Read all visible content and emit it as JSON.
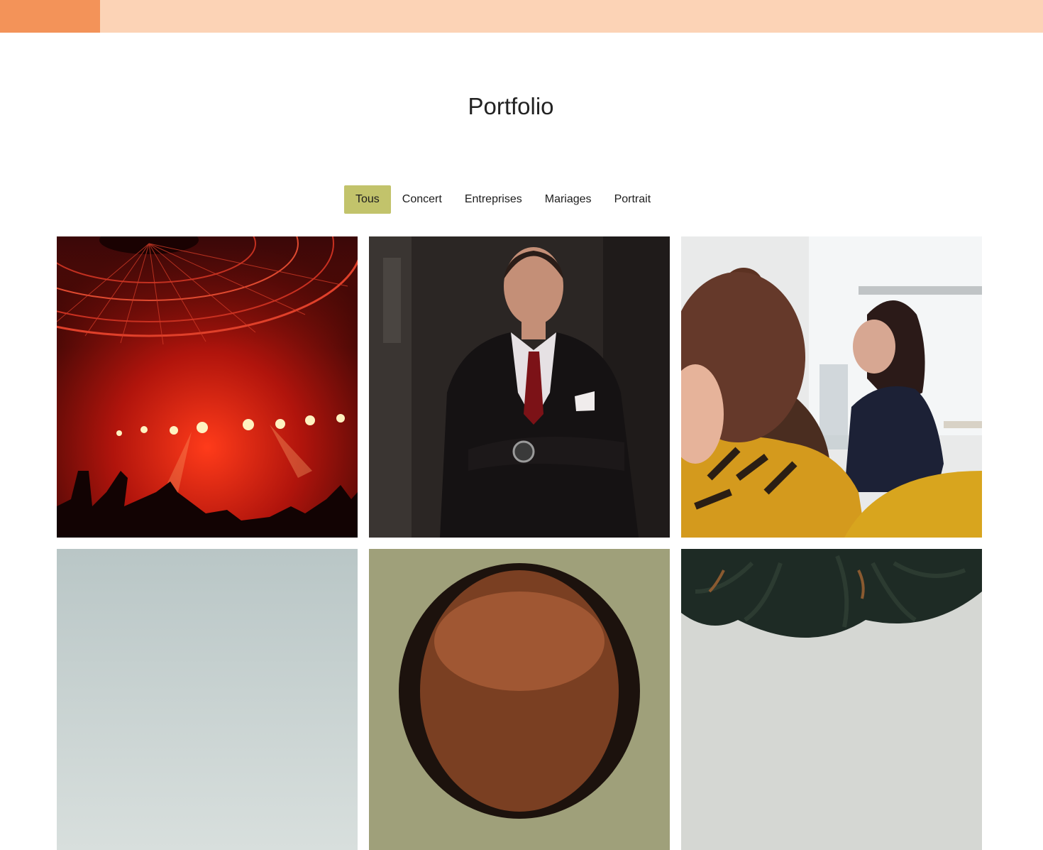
{
  "header": {
    "bar_color": "#fcd3b6",
    "accent_color": "#f39359"
  },
  "page": {
    "title": "Portfolio"
  },
  "filters": {
    "active_color": "#c2c36b",
    "items": [
      {
        "label": "Tous",
        "active": true
      },
      {
        "label": "Concert",
        "active": false
      },
      {
        "label": "Entreprises",
        "active": false
      },
      {
        "label": "Mariages",
        "active": false
      },
      {
        "label": "Portrait",
        "active": false
      }
    ]
  },
  "gallery": {
    "items": [
      {
        "subject": "concert-stage-photo"
      },
      {
        "subject": "businessman-portrait-photo"
      },
      {
        "subject": "office-meeting-photo"
      },
      {
        "subject": "sky-photo"
      },
      {
        "subject": "man-portrait-photo"
      },
      {
        "subject": "palm-trees-photo"
      }
    ]
  }
}
